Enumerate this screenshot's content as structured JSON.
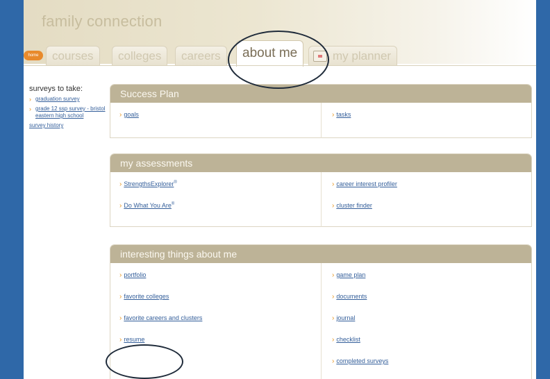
{
  "app": {
    "title": "family connection",
    "home_badge": "home"
  },
  "tabs": [
    {
      "label": "courses"
    },
    {
      "label": "colleges"
    },
    {
      "label": "careers"
    },
    {
      "label": "about me",
      "active": true
    },
    {
      "label": "my planner",
      "icon": "planner-icon"
    }
  ],
  "sidebar": {
    "title": "surveys to take:",
    "links": [
      {
        "label": "graduation survey"
      },
      {
        "label": "grade 12 ssp survey - bristol eastern high school"
      }
    ],
    "history_label": "survey history"
  },
  "panels": {
    "success_plan": {
      "title": "Success Plan",
      "left": [
        {
          "label": "goals"
        }
      ],
      "right": [
        {
          "label": "tasks"
        }
      ]
    },
    "assessments": {
      "title": "my assessments",
      "left": [
        {
          "label": "StrengthsExplorer",
          "sup": "®"
        },
        {
          "label": "Do What You Are",
          "sup": "®"
        }
      ],
      "right": [
        {
          "label": "career interest profiler"
        },
        {
          "label": "cluster finder"
        }
      ]
    },
    "interesting": {
      "title": "interesting things about me",
      "left": [
        {
          "label": "portfolio"
        },
        {
          "label": "favorite colleges"
        },
        {
          "label": "favorite careers and clusters"
        },
        {
          "label": "resume"
        }
      ],
      "right": [
        {
          "label": "game plan"
        },
        {
          "label": "documents"
        },
        {
          "label": "journal"
        },
        {
          "label": "checklist"
        },
        {
          "label": "completed surveys"
        }
      ]
    }
  },
  "colors": {
    "side_band": "#2f68a8",
    "panel_header": "#bdb397",
    "link": "#335e9a",
    "arrow": "#e8941c"
  }
}
